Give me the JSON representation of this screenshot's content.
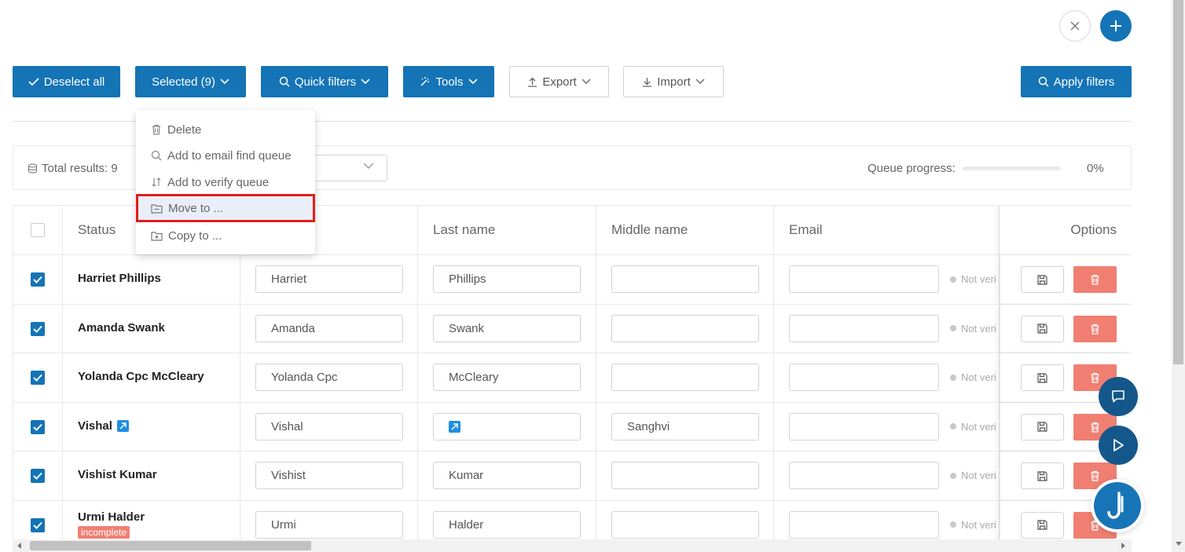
{
  "top_actions": {
    "close_icon": "close-icon",
    "add_icon": "plus-icon"
  },
  "toolbar": {
    "deselect_all": "Deselect all",
    "selected": "Selected (9)",
    "quick_filters": "Quick filters",
    "tools": "Tools",
    "export": "Export",
    "import": "Import",
    "apply_filters": "Apply filters"
  },
  "dropdown": {
    "items": [
      {
        "label": "Delete",
        "icon": "trash-icon"
      },
      {
        "label": "Add to email find queue",
        "icon": "search-icon"
      },
      {
        "label": "Add to verify queue",
        "icon": "sort-icon"
      },
      {
        "label": "Move to ...",
        "icon": "folder-icon"
      },
      {
        "label": "Copy to ...",
        "icon": "folder-plus-icon"
      }
    ],
    "active_index": 3
  },
  "results": {
    "total": "Total results: 9",
    "queue_label": "Queue progress:",
    "queue_progress": 0,
    "queue_pct": "0%"
  },
  "table": {
    "headers": {
      "status": "Status",
      "first_name": "First name",
      "first_name_visible": "e",
      "last_name": "Last name",
      "middle_name": "Middle name",
      "email": "Email",
      "options": "Options"
    },
    "rows": [
      {
        "name": "Harriet Phillips",
        "first": "Harriet",
        "last": "Phillips",
        "middle": "",
        "email": "",
        "verify": "Not veri",
        "badge": "",
        "link": false,
        "last_link": false
      },
      {
        "name": "Amanda Swank",
        "first": "Amanda",
        "last": "Swank",
        "middle": "",
        "email": "",
        "verify": "Not veri",
        "badge": "",
        "link": false,
        "last_link": false
      },
      {
        "name": "Yolanda Cpc McCleary",
        "first": "Yolanda Cpc",
        "last": "McCleary",
        "middle": "",
        "email": "",
        "verify": "Not veri",
        "badge": "",
        "link": false,
        "last_link": false
      },
      {
        "name": "Vishal",
        "first": "Vishal",
        "last": "",
        "middle": "Sanghvi",
        "email": "",
        "verify": "Not veri",
        "badge": "",
        "link": true,
        "last_link": true
      },
      {
        "name": "Vishist Kumar",
        "first": "Vishist",
        "last": "Kumar",
        "middle": "",
        "email": "",
        "verify": "Not veri",
        "badge": "",
        "link": false,
        "last_link": false
      },
      {
        "name": "Urmi Halder",
        "first": "Urmi",
        "last": "Halder",
        "middle": "",
        "email": "",
        "verify": "Not veri",
        "badge": "incomplete",
        "link": false,
        "last_link": false
      }
    ]
  },
  "colors": {
    "primary": "#1474b6",
    "danger": "#f07f72",
    "highlight_border": "#e31d1d"
  }
}
